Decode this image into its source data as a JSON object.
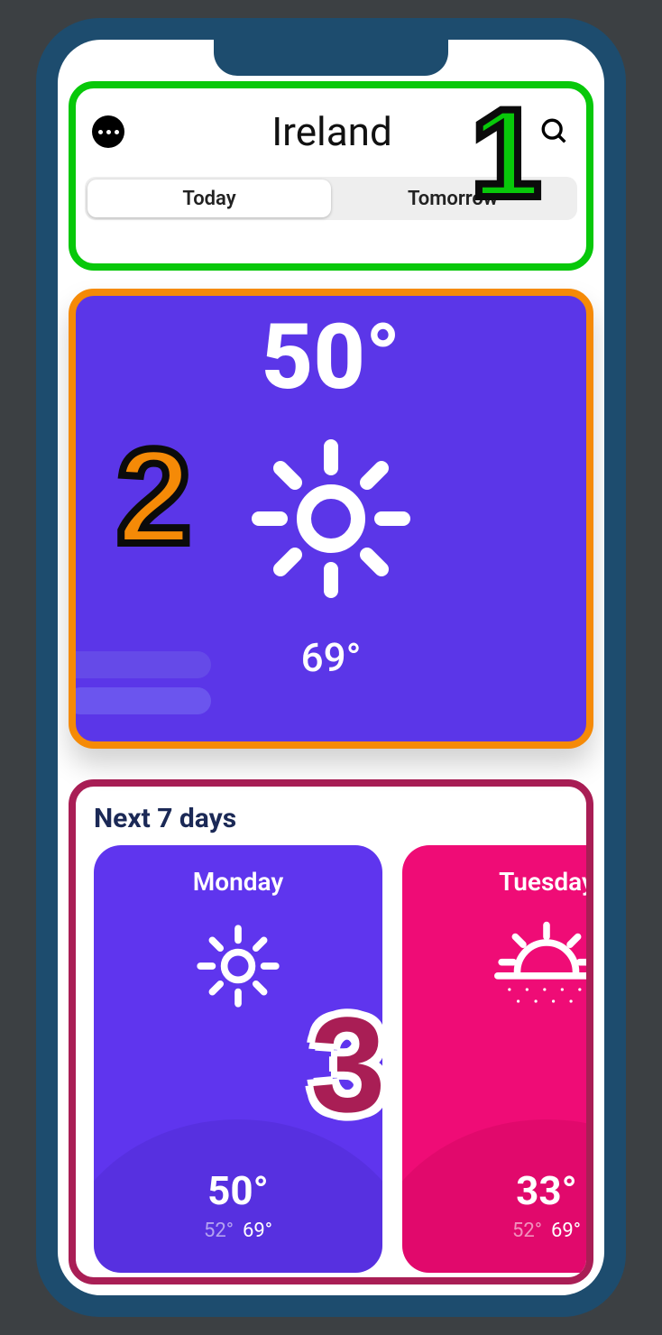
{
  "header": {
    "location": "Ireland",
    "tabs": {
      "today": "Today",
      "tomorrow": "Tomorrow",
      "active": "today"
    }
  },
  "hero": {
    "temp": "50°",
    "secondary_temp": "69°",
    "icon": "sun-icon"
  },
  "forecast": {
    "title": "Next 7 days",
    "days": [
      {
        "name": "Monday",
        "icon": "sun-icon",
        "temp": "50°",
        "lo": "52°",
        "hi": "69°",
        "color": "#5f35ee"
      },
      {
        "name": "Tuesday",
        "icon": "sunset-haze-icon",
        "temp": "33°",
        "lo": "52°",
        "hi": "69°",
        "color": "#ef0c76"
      }
    ]
  },
  "annotations": {
    "n1": "1",
    "n2": "2",
    "n3": "3"
  }
}
